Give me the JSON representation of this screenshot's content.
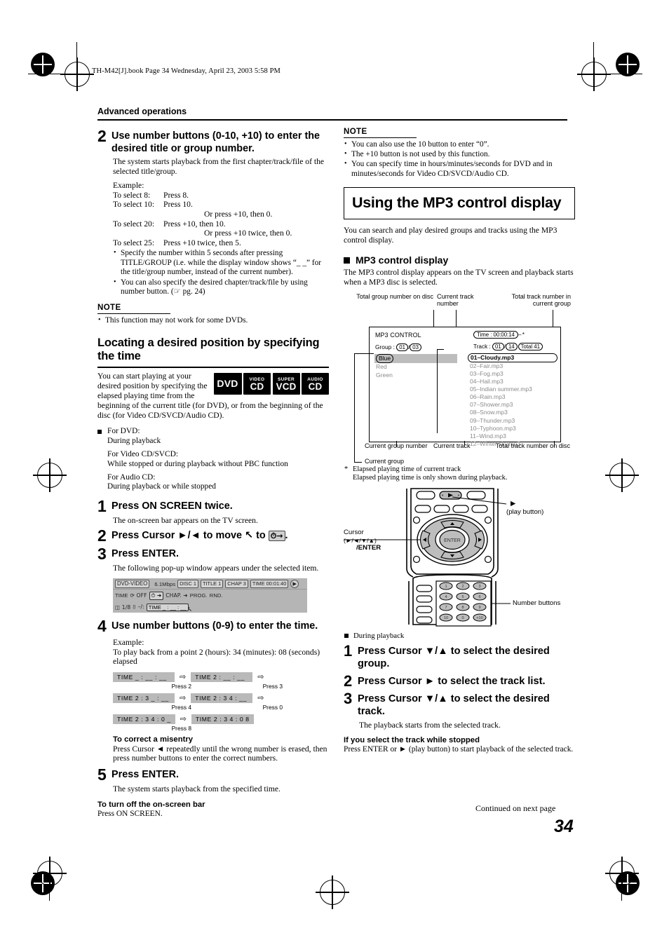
{
  "header": {
    "file_line": "TH-M42[J].book  Page 34  Wednesday, April 23, 2003  5:58 PM",
    "section": "Advanced operations"
  },
  "left": {
    "step2": {
      "num": "2",
      "title": "Use number buttons (0-10, +10) to enter the desired title or group number.",
      "body": "The system starts playback from the first chapter/track/file of the selected title/group.",
      "example_label": "Example:",
      "examples": [
        {
          "label": "To select 8:",
          "action": "Press 8."
        },
        {
          "label": "To select 10:",
          "action": "Press 10."
        },
        {
          "label": "",
          "action": "Or press +10, then 0."
        },
        {
          "label": "To select 20:",
          "action": "Press +10, then 10."
        },
        {
          "label": "",
          "action": "Or press +10 twice, then 0."
        },
        {
          "label": "To select 25:",
          "action": "Press +10 twice, then 5."
        }
      ],
      "bullets": [
        "Specify the number within 5 seconds after pressing TITLE/GROUP (i.e. while the display window shows “_ _” for the title/group number, instead of the current number).",
        "You can also specify the desired chapter/track/file by using number button. (☞ pg. 24)"
      ]
    },
    "note1": {
      "title": "NOTE",
      "items": [
        "This function may not work for some DVDs."
      ]
    },
    "heading": "Locating a desired position by specifying the time",
    "intro": "You can start playing at your desired position by specifying the elapsed playing time from the beginning of the current title (for DVD), or from the beginning of the disc (for Video CD/SVCD/Audio CD).",
    "badges": [
      {
        "top": "",
        "bottom": "DVD"
      },
      {
        "top": "VIDEO",
        "bottom": "CD"
      },
      {
        "top": "SUPER",
        "bottom": "VCD"
      },
      {
        "top": "AUDIO",
        "bottom": "CD"
      }
    ],
    "conditions": [
      "For DVD:",
      "During playback",
      "For Video CD/SVCD:",
      "While stopped or during playback without PBC function",
      "For Audio CD:",
      "During playback or while stopped"
    ],
    "step1": {
      "num": "1",
      "title": "Press ON SCREEN twice.",
      "body": "The on-screen bar appears on the TV screen."
    },
    "step2b": {
      "num": "2",
      "title_a": "Press Cursor ►/◄ to move",
      "title_b": "to",
      "cursor_glyph": "↖",
      "clock_glyph": "⏱→"
    },
    "step3": {
      "num": "3",
      "title": "Press ENTER.",
      "body": "The following pop-up window appears under the selected item."
    },
    "onscreen_bar": {
      "row1": [
        "DVD-VIDEO",
        "6.1Mbps",
        "DISC 1",
        "TITLE  1",
        "CHAP  3",
        "TIME 00:01:40",
        "▶"
      ],
      "row2": [
        "TIME",
        "⟳ OFF",
        "⏱ ➜",
        "CHAP. ➜",
        "PROG.",
        "RND."
      ],
      "row3": [
        "◫ 1/8",
        "⌷ –/:",
        "TIME  _ : __ : __"
      ]
    },
    "step4": {
      "num": "4",
      "title": "Use number buttons (0-9) to enter the time.",
      "example_label": "Example:",
      "example_body": "To play back from a point 2 (hours): 34 (minutes): 08 (seconds) elapsed"
    },
    "time_sequence": [
      {
        "a": "TIME   _ : __ : __",
        "a_cap": "Press 2",
        "b": "TIME  2 : __ : __",
        "b_cap": "Press 3",
        "trail": true
      },
      {
        "a": "TIME   2 : 3 _ : __",
        "a_cap": "Press 4",
        "b": "TIME  2 : 3 4 : __",
        "b_cap": "Press 0",
        "trail": true
      },
      {
        "a": "TIME   2 : 3 4 : 0 _",
        "a_cap": "Press 8",
        "b": "TIME  2 : 3 4 : 0 8",
        "b_cap": "",
        "trail": false
      }
    ],
    "correct": {
      "title": "To correct a misentry",
      "body": "Press Cursor ◄ repeatedly until the wrong number is erased, then press number buttons to enter the correct numbers."
    },
    "step5": {
      "num": "5",
      "title": "Press ENTER.",
      "body": "The system starts playback from the specified time."
    },
    "turnoff": {
      "title": "To turn off the on-screen bar",
      "body": "Press ON SCREEN."
    }
  },
  "right": {
    "note2": {
      "title": "NOTE",
      "items": [
        "You can also use the 10 button to enter “0”.",
        "The +10 button is not used by this function.",
        "You can specify time in hours/minutes/seconds for DVD and in minutes/seconds for Video CD/SVCD/Audio CD."
      ]
    },
    "box_heading": "Using the MP3 control display",
    "intro": "You can search and play desired groups and tracks using the MP3 control display.",
    "sub_heading": "MP3 control display",
    "sub_body": "The MP3 control display appears on the TV screen and playback starts when a MP3 disc is selected.",
    "diagram": {
      "callouts_top": [
        "Total group number on disc",
        "Current track number",
        "Total track number in current group"
      ],
      "callouts_bottom": [
        "Current group number",
        "Current track",
        "Total track number on disc",
        "Current group"
      ],
      "screen_title": "MP3 CONTROL",
      "group_label": "Group :",
      "group_current": "01",
      "group_sep": "/",
      "group_total": "03",
      "time_label": "Time :",
      "time_value": "00:00:14",
      "time_star": "*",
      "track_label": "Track :",
      "track_current": "01",
      "track_sep": "/",
      "track_total": "14",
      "track_total_disc": "Total 41",
      "groups": [
        "Blue",
        "Red",
        "Green"
      ],
      "tracks": [
        "01–Cloudy.mp3",
        "02–Fair.mp3",
        "03–Fog.mp3",
        "04–Hail.mp3",
        "05–Indian summer.mp3",
        "06–Rain.mp3",
        "07–Shower.mp3",
        "08–Snow.mp3",
        "09–Thunder.mp3",
        "10–Typhoon.mp3",
        "11–Wind.mp3",
        "12–Winter sky.mp3"
      ]
    },
    "footnote": "Elapsed playing time of current track Elapsed playing time is only shown during playback.",
    "remote": {
      "play_glyph": "▶",
      "play_label": "(play button)",
      "cursor_label": "Cursor",
      "cursor_glyphs": "(►/◄/▼/▲)",
      "cursor_enter": "/ENTER",
      "enter_label": "ENTER",
      "number_label": "Number buttons",
      "keys": [
        "1",
        "2",
        "3",
        "4",
        "5",
        "6",
        "7",
        "8",
        "9",
        "10",
        "0",
        "+10"
      ]
    },
    "during_playback": "During playback",
    "step1": {
      "num": "1",
      "title": "Press Cursor ▼/▲ to select the desired group."
    },
    "step2": {
      "num": "2",
      "title": "Press Cursor ► to select the track list."
    },
    "step3": {
      "num": "3",
      "title": "Press Cursor ▼/▲ to select the desired track.",
      "body": "The playback starts from the selected track."
    },
    "stopped": {
      "title": "If you select the track while stopped",
      "body": "Press ENTER or ► (play button) to start playback of the selected track."
    }
  },
  "footer": {
    "continued": "Continued on next page",
    "page": "34"
  }
}
